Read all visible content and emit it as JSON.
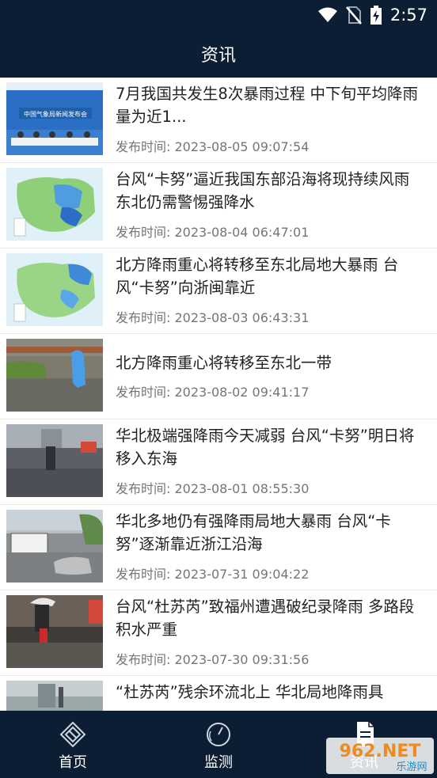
{
  "status_bar": {
    "time": "2:57"
  },
  "header": {
    "title": "资讯"
  },
  "news": [
    {
      "title": "7月我国共发生8次暴雨过程 中下旬平均降雨量为近1...",
      "date": "发布时间: 2023-08-05 09:07:54"
    },
    {
      "title": "台风“卡努”逼近我国东部沿海将现持续风雨 东北仍需警惕强降水",
      "date": "发布时间: 2023-08-04 06:47:01"
    },
    {
      "title": "北方降雨重心将转移至东北局地大暴雨 台风“卡努”向浙闽靠近",
      "date": "发布时间: 2023-08-03 06:43:31"
    },
    {
      "title": "北方降雨重心将转移至东北一带",
      "date": "发布时间: 2023-08-02 09:41:17"
    },
    {
      "title": "华北极端强降雨今天减弱 台风“卡努”明日将移入东海",
      "date": "发布时间: 2023-08-01 08:55:30"
    },
    {
      "title": "华北多地仍有强降雨局地大暴雨 台风“卡努”逐渐靠近浙江沿海",
      "date": "发布时间: 2023-07-31 09:04:22"
    },
    {
      "title": "台风“杜苏芮”致福州遭遇破纪录降雨 多路段积水严重",
      "date": "发布时间: 2023-07-30 09:31:56"
    },
    {
      "title": "“杜苏芮”残余环流北上 华北局地降雨具",
      "date": ""
    }
  ],
  "thumb_text": {
    "press_banner": "中国气象局新闻发布会"
  },
  "nav": [
    {
      "label": "首页",
      "icon": "home-icon"
    },
    {
      "label": "监测",
      "icon": "gauge-icon"
    },
    {
      "label": "资讯",
      "icon": "news-icon"
    }
  ],
  "watermark": {
    "text": "962.NET",
    "sub": "乐游网"
  },
  "colors": {
    "bar_bg": "#0c1e33",
    "text_dark": "#222222",
    "text_gray": "#757575"
  }
}
